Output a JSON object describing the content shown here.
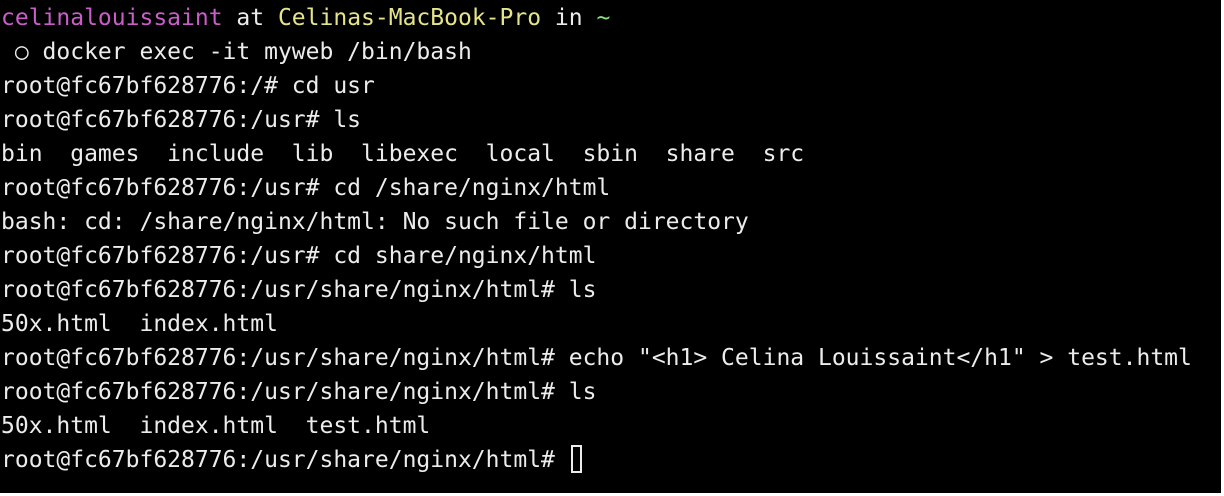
{
  "prompt_header": {
    "user": "celinalouissaint",
    "at": " at ",
    "host": "Celinas-MacBook-Pro",
    "in": " in ",
    "dir": "~"
  },
  "lines": [
    " ○ docker exec -it myweb /bin/bash",
    "root@fc67bf628776:/# cd usr",
    "root@fc67bf628776:/usr# ls",
    "bin  games  include  lib  libexec  local  sbin  share  src",
    "root@fc67bf628776:/usr# cd /share/nginx/html",
    "bash: cd: /share/nginx/html: No such file or directory",
    "root@fc67bf628776:/usr# cd share/nginx/html",
    "root@fc67bf628776:/usr/share/nginx/html# ls",
    "50x.html  index.html",
    "root@fc67bf628776:/usr/share/nginx/html# echo \"<h1> Celina Louissaint</h1\" > test.html",
    "root@fc67bf628776:/usr/share/nginx/html# ls",
    "50x.html  index.html  test.html"
  ],
  "current_prompt": "root@fc67bf628776:/usr/share/nginx/html# ",
  "colors": {
    "background": "#000000",
    "foreground": "#ececec",
    "user": "#c95ec9",
    "host": "#e6e48a",
    "tilde": "#86e07b"
  }
}
